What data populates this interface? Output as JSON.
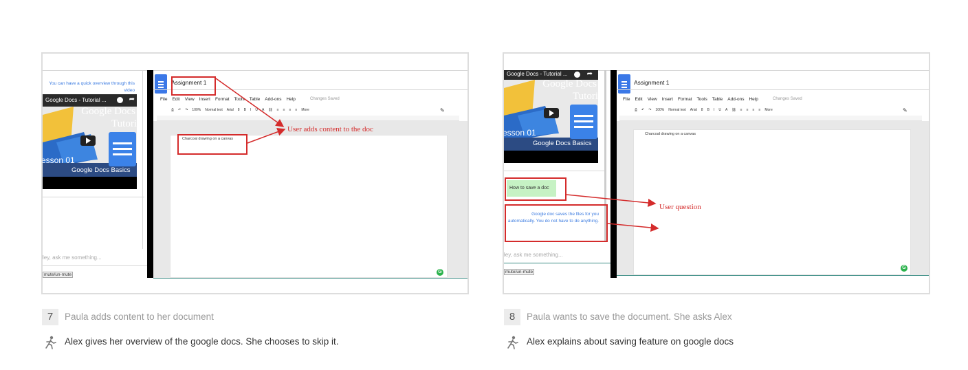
{
  "steps": [
    {
      "number": "7",
      "title": "Paula adds content to her document",
      "detail": "Alex gives her overview of the google docs. She chooses to skip it.",
      "screen": {
        "intro": "You can have a quick overview through this video",
        "video_title": "Google Docs - Tutorial ...",
        "video_brand": "Google Docs",
        "video_tutorial": "Tutori",
        "video_lesson": "esson 01",
        "video_subtitle": "Google Docs Basics",
        "chat_placeholder": "Hey, ask me something...",
        "mute_label": "mute/un-mute",
        "doc_title": "Assignment 1",
        "menu": [
          "File",
          "Edit",
          "View",
          "Insert",
          "Format",
          "Tools",
          "Table",
          "Add-ons",
          "Help"
        ],
        "save_status": "Changes Saved",
        "zoom": "100%",
        "style": "Normal text",
        "font": "Arial",
        "font_size": "8",
        "more": "More",
        "doc_text": "Charcoal drawing on a canvas",
        "annotation": "User adds content to the doc"
      }
    },
    {
      "number": "8",
      "title": "Paula wants to save the document. She asks Alex",
      "detail": "Alex explains about saving feature on google docs",
      "screen": {
        "video_title": "Google Docs - Tutorial ...",
        "video_brand": "Google Docs",
        "video_tutorial": "Tutori",
        "video_lesson": "esson 01",
        "video_subtitle": "Google Docs Basics",
        "user_message": "How to save a doc",
        "bot_message": "Google doc saves the files for you automatically. You do not have to do anything.",
        "chat_placeholder": "Hey, ask me something...",
        "mute_label": "mute/un-mute",
        "doc_title": "Assignment 1",
        "menu": [
          "File",
          "Edit",
          "View",
          "Insert",
          "Format",
          "Tools",
          "Table",
          "Add-ons",
          "Help"
        ],
        "save_status": "Changes Saved",
        "zoom": "100%",
        "style": "Normal text",
        "font": "Arial",
        "font_size": "8",
        "more": "More",
        "doc_text": "Charcoal drawing on a canvas",
        "annotation": "User question"
      }
    }
  ],
  "icons": {
    "walk": "walking-person-icon",
    "docs": "google-docs-icon",
    "play": "play-icon",
    "share": "share-icon",
    "grammarly": "grammarly-icon"
  },
  "colors": {
    "annotation_red": "#d42b2b",
    "docs_blue": "#3b78e7",
    "bot_text_blue": "#3b7be0",
    "user_chip_green": "#c6f2c4"
  }
}
